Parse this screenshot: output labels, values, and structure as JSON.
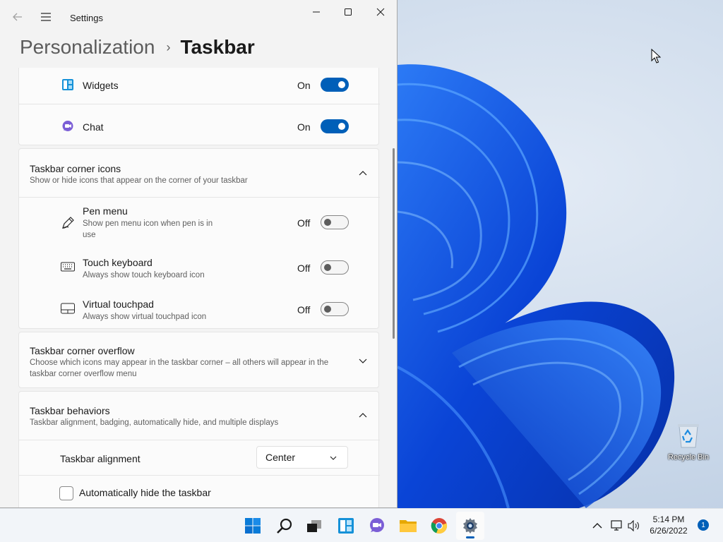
{
  "window": {
    "title": "Settings",
    "controls": {
      "minimize": "minimize",
      "maximize": "maximize",
      "close": "close"
    }
  },
  "breadcrumb": {
    "parent": "Personalization",
    "separator": "›",
    "current": "Taskbar"
  },
  "taskbar_items": [
    {
      "label": "Widgets",
      "state": "On",
      "on": true,
      "icon": "widgets-icon"
    },
    {
      "label": "Chat",
      "state": "On",
      "on": true,
      "icon": "chat-icon"
    }
  ],
  "corner_icons": {
    "title": "Taskbar corner icons",
    "description": "Show or hide icons that appear on the corner of your taskbar",
    "expanded": true,
    "items": [
      {
        "label": "Pen menu",
        "desc_line1": "Show pen menu icon when pen is in",
        "desc_line2": "use",
        "state": "Off",
        "on": false,
        "icon": "pen-icon"
      },
      {
        "label": "Touch keyboard",
        "desc": "Always show touch keyboard icon",
        "state": "Off",
        "on": false,
        "icon": "keyboard-icon"
      },
      {
        "label": "Virtual touchpad",
        "desc": "Always show virtual touchpad icon",
        "state": "Off",
        "on": false,
        "icon": "touchpad-icon"
      }
    ]
  },
  "corner_overflow": {
    "title": "Taskbar corner overflow",
    "desc_line1": "Choose which icons may appear in the taskbar corner – all others will appear in the",
    "desc_line2": "taskbar corner overflow menu",
    "expanded": false
  },
  "behaviors": {
    "title": "Taskbar behaviors",
    "description": "Taskbar alignment, badging, automatically hide, and multiple displays",
    "expanded": true,
    "alignment_label": "Taskbar alignment",
    "alignment_value": "Center",
    "autohide_label": "Automatically hide the taskbar",
    "autohide_checked": false
  },
  "desktop": {
    "recycle_bin_label": "Recycle Bin"
  },
  "system_taskbar": {
    "apps": [
      "start-icon",
      "search-icon",
      "task-view-icon",
      "widgets-icon",
      "chat-icon",
      "file-explorer-icon",
      "chrome-icon",
      "settings-icon"
    ],
    "active_app": "settings-icon",
    "time": "5:14 PM",
    "date": "6/26/2022",
    "notification_count": "1"
  },
  "colors": {
    "accent": "#005fb8",
    "window_bg": "#f3f3f3",
    "card_bg": "#fbfbfb",
    "bloom": "#0a4fd8"
  }
}
